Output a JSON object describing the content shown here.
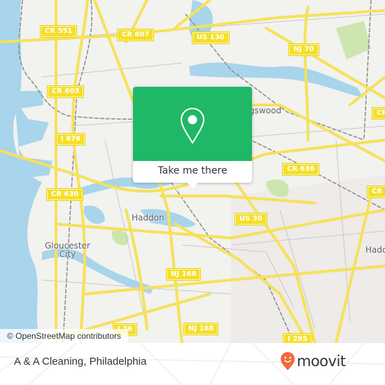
{
  "map": {
    "shields": [
      {
        "label": "CR 551"
      },
      {
        "label": "CR 607"
      },
      {
        "label": "US 130"
      },
      {
        "label": "NJ 70"
      },
      {
        "label": "CR 603"
      },
      {
        "label": "I 676"
      },
      {
        "label": "CR 636"
      },
      {
        "label": "CR 630"
      },
      {
        "label": "US 30"
      },
      {
        "label": "NJ 168"
      },
      {
        "label": "NJ 168"
      },
      {
        "label": "I 76"
      },
      {
        "label": "I 295"
      },
      {
        "label": "CR"
      },
      {
        "label": "CR"
      }
    ],
    "places": [
      {
        "label": "Haddon"
      },
      {
        "label": "Gloucester\nCity"
      },
      {
        "label": "Collingswood",
        "visible_part": "gswood"
      },
      {
        "label": "Haddon",
        "visible_part": "Hadd"
      }
    ],
    "attribution": "© OpenStreetMap contributors",
    "colors": {
      "water": "#a8d4ec",
      "land": "#f2f2ef",
      "road": "#f6e15a",
      "park": "#cde6b0"
    }
  },
  "popup": {
    "button_label": "Take me there",
    "color": "#1fb866"
  },
  "footer": {
    "place_title": "A & A Cleaning, Philadelphia",
    "brand": "moovit",
    "brand_color": "#f26a3a"
  }
}
